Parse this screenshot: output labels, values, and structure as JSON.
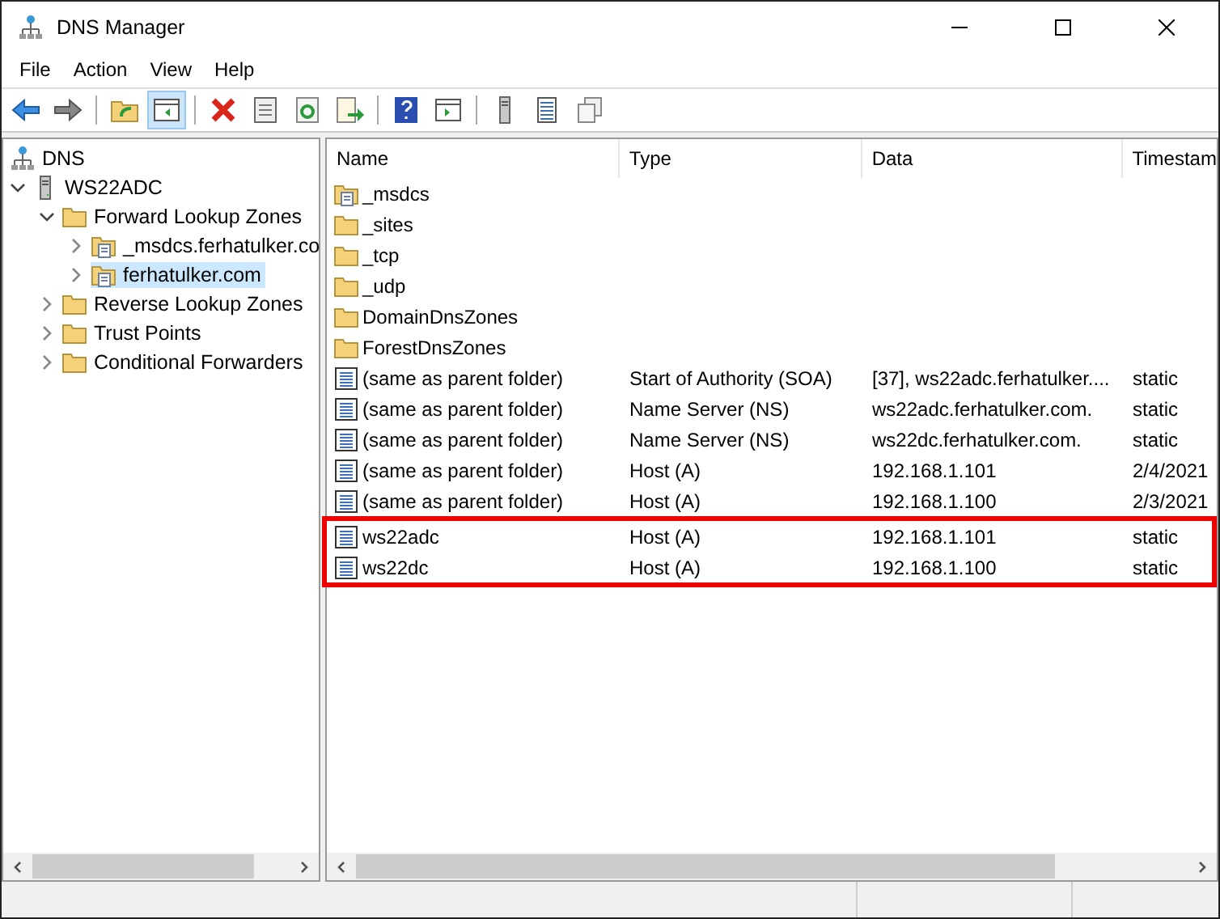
{
  "window": {
    "title": "DNS Manager"
  },
  "menu": [
    "File",
    "Action",
    "View",
    "Help"
  ],
  "tree": [
    {
      "label": "DNS",
      "kind": "dns",
      "selected": false,
      "children": [
        {
          "label": "WS22ADC",
          "kind": "server",
          "expanded": true,
          "selected": false,
          "children": [
            {
              "label": "Forward Lookup Zones",
              "kind": "folder",
              "expanded": true,
              "selected": false,
              "children": [
                {
                  "label": "_msdcs.ferhatulker.co",
                  "kind": "zone",
                  "expanded": false,
                  "selected": false
                },
                {
                  "label": "ferhatulker.com",
                  "kind": "zone",
                  "expanded": false,
                  "selected": true
                }
              ]
            },
            {
              "label": "Reverse Lookup Zones",
              "kind": "folder",
              "expanded": false,
              "selected": false
            },
            {
              "label": "Trust Points",
              "kind": "folder",
              "expanded": false,
              "selected": false
            },
            {
              "label": "Conditional Forwarders",
              "kind": "folder",
              "expanded": false,
              "selected": false
            }
          ]
        }
      ]
    }
  ],
  "table": {
    "columns": [
      "Name",
      "Type",
      "Data",
      "Timestam"
    ],
    "rows": [
      {
        "kind": "zone",
        "name": "_msdcs",
        "highlighted": false
      },
      {
        "kind": "folder",
        "name": "_sites",
        "highlighted": false
      },
      {
        "kind": "folder",
        "name": "_tcp",
        "highlighted": false
      },
      {
        "kind": "folder",
        "name": "_udp",
        "highlighted": false
      },
      {
        "kind": "folder",
        "name": "DomainDnsZones",
        "highlighted": false
      },
      {
        "kind": "folder",
        "name": "ForestDnsZones",
        "highlighted": false
      },
      {
        "kind": "record",
        "name": "(same as parent folder)",
        "type": "Start of Authority (SOA)",
        "data": "[37], ws22adc.ferhatulker....",
        "timestamp": "static",
        "highlighted": false
      },
      {
        "kind": "record",
        "name": "(same as parent folder)",
        "type": "Name Server (NS)",
        "data": "ws22adc.ferhatulker.com.",
        "timestamp": "static",
        "highlighted": false
      },
      {
        "kind": "record",
        "name": "(same as parent folder)",
        "type": "Name Server (NS)",
        "data": "ws22dc.ferhatulker.com.",
        "timestamp": "static",
        "highlighted": false
      },
      {
        "kind": "record",
        "name": "(same as parent folder)",
        "type": "Host (A)",
        "data": "192.168.1.101",
        "timestamp": "2/4/2021",
        "highlighted": false
      },
      {
        "kind": "record",
        "name": "(same as parent folder)",
        "type": "Host (A)",
        "data": "192.168.1.100",
        "timestamp": "2/3/2021",
        "highlighted": false
      },
      {
        "kind": "record",
        "name": "ws22adc",
        "type": "Host (A)",
        "data": "192.168.1.101",
        "timestamp": "static",
        "highlighted": true
      },
      {
        "kind": "record",
        "name": "ws22dc",
        "type": "Host (A)",
        "data": "192.168.1.100",
        "timestamp": "static",
        "highlighted": true
      }
    ]
  }
}
